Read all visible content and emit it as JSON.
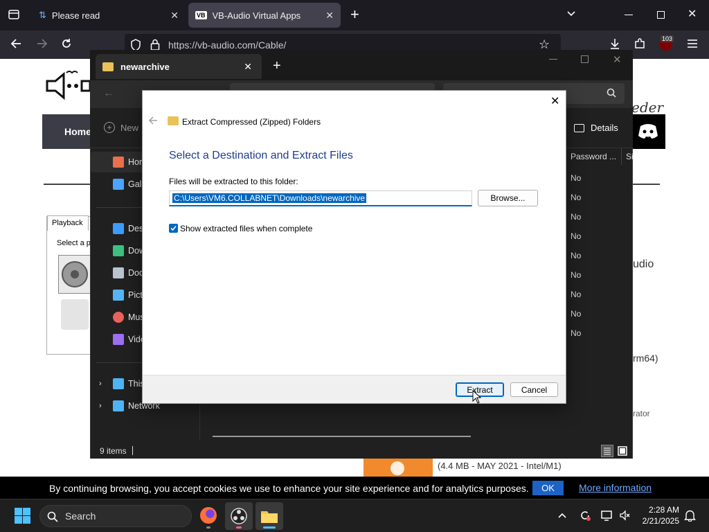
{
  "browser": {
    "tabs": [
      {
        "title": "Please read",
        "active": false
      },
      {
        "title": "VB-Audio Virtual Apps",
        "active": true
      }
    ],
    "url": "https://vb-audio.com/Cable/",
    "badge_count": "103"
  },
  "website": {
    "nav_home": "Home",
    "details_label": "Details",
    "tab_playback": "Playback",
    "select_text": "Select a p",
    "right_audio": "udio",
    "right_arm": "rm64)",
    "right_rator": "rator",
    "download_text": "(4.4 MB - MAY 2021 - Intel/M1)"
  },
  "explorer": {
    "title": "newarchive",
    "new_label": "New",
    "details_label": "Details",
    "column_password": "Password ...",
    "column_size": "Si",
    "password_values": [
      "No",
      "No",
      "No",
      "No",
      "No",
      "No",
      "No",
      "No",
      "No"
    ],
    "nav_items": [
      {
        "label": "Hor",
        "icon": "home-icon",
        "color": "#e8704c"
      },
      {
        "label": "Gall",
        "icon": "gallery-icon",
        "color": "#4aa3ff"
      },
      {
        "label": "Desl",
        "icon": "desktop-icon",
        "color": "#3b9cff"
      },
      {
        "label": "Dow",
        "icon": "download-icon",
        "color": "#3cc080"
      },
      {
        "label": "Doc",
        "icon": "documents-icon",
        "color": "#b9c3cf"
      },
      {
        "label": "Pict",
        "icon": "pictures-icon",
        "color": "#56b4f6"
      },
      {
        "label": "Mus",
        "icon": "music-icon",
        "color": "#e9625b"
      },
      {
        "label": "Vide",
        "icon": "videos-icon",
        "color": "#9c6ef0"
      },
      {
        "label": "This",
        "icon": "this-pc-icon",
        "color": "#4fb4f5"
      },
      {
        "label": "Network",
        "icon": "network-icon",
        "color": "#4fb4f5"
      }
    ],
    "status": "9 items"
  },
  "dialog": {
    "breadcrumb_title": "Extract Compressed (Zipped) Folders",
    "heading": "Select a Destination and Extract Files",
    "folder_label": "Files will be extracted to this folder:",
    "path_value": "C:\\Users\\VM6.COLLABNET\\Downloads\\newarchive",
    "browse_label": "Browse...",
    "checkbox_label": "Show extracted files when complete",
    "checkbox_checked": true,
    "extract_label": "Extract",
    "cancel_label": "Cancel"
  },
  "cookie": {
    "text": "By continuing browsing, you accept cookies we use to enhance your site experience and for analytics purposes.",
    "ok_label": "OK",
    "more_label": "More information"
  },
  "taskbar": {
    "search_placeholder": "Search",
    "time": "2:28 AM",
    "date": "2/21/2025"
  },
  "colors": {
    "accent_blue": "#0067c0",
    "dialog_heading": "#1f3d8c",
    "cookie_ok": "#1c63c5",
    "cookie_link": "#6ea8ff"
  }
}
